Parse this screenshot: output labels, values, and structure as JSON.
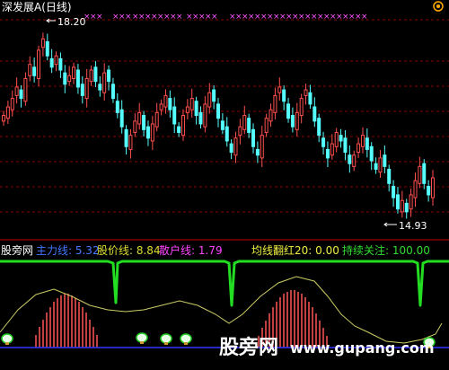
{
  "window": {
    "title": "深发展A(日线)"
  },
  "colors": {
    "background": "#000000",
    "grid": "#8a0000",
    "up": "#ff5050",
    "down": "#55ffff",
    "marker": "#ff55ff",
    "green": "#22cc22",
    "yellow": "#cccc66",
    "blue": "#3333ff",
    "white": "#ffffff",
    "volume": "#ff5555"
  },
  "chart_data": [
    {
      "type": "candlestick",
      "title": "深发展A(日线)",
      "annotations": [
        {
          "label": "18.20",
          "value": 18.2
        },
        {
          "label": "14.93",
          "value": 14.93
        }
      ],
      "approx_ylim": [
        14.7,
        18.5
      ],
      "close": [
        16.75,
        16.9,
        17.05,
        17.25,
        17.05,
        17.4,
        17.65,
        17.45,
        17.9,
        18.1,
        17.8,
        17.6,
        17.8,
        17.55,
        17.3,
        17.45,
        17.6,
        17.25,
        17.1,
        17.4,
        17.55,
        17.35,
        17.2,
        17.5,
        17.35,
        17.05,
        16.8,
        16.55,
        16.2,
        16.4,
        16.65,
        16.8,
        16.5,
        16.35,
        16.6,
        16.8,
        16.95,
        17.1,
        16.85,
        16.6,
        16.45,
        16.75,
        16.9,
        17.05,
        16.75,
        16.6,
        16.95,
        17.15,
        17.0,
        16.7,
        16.5,
        16.3,
        16.1,
        16.35,
        16.55,
        16.75,
        16.45,
        16.2,
        16.05,
        16.4,
        16.7,
        16.85,
        17.1,
        17.25,
        17.0,
        16.7,
        16.55,
        16.8,
        17.05,
        17.2,
        16.95,
        16.65,
        16.4,
        16.2,
        16.0,
        16.25,
        16.45,
        16.3,
        16.1,
        15.9,
        16.05,
        16.25,
        16.4,
        16.15,
        15.95,
        15.8,
        16.0,
        15.85,
        15.55,
        15.3,
        15.1,
        15.25,
        15.05,
        15.35,
        15.6,
        15.85,
        15.55,
        15.35,
        15.65
      ]
    },
    {
      "type": "indicator",
      "labels": [
        "股旁网",
        "主力线",
        "股价线",
        "散户线",
        "均线翻红",
        "持续关注"
      ],
      "values": {
        "主力线": 5.32,
        "股价线": 8.84,
        "散户线": 1.79,
        "均线翻红": 0.0,
        "持续关注": 100.0
      },
      "legend_text": {
        "brand": "股旁网",
        "main": "主力线: 5.32",
        "price": "股价线: 8.84",
        "retail": "散户线: 1.79",
        "red": "均线翻红20: 0.00",
        "focus": "持续关注: 100.00"
      }
    }
  ],
  "watermark": {
    "cn": "股旁网",
    "url": "www.gupang.com"
  }
}
